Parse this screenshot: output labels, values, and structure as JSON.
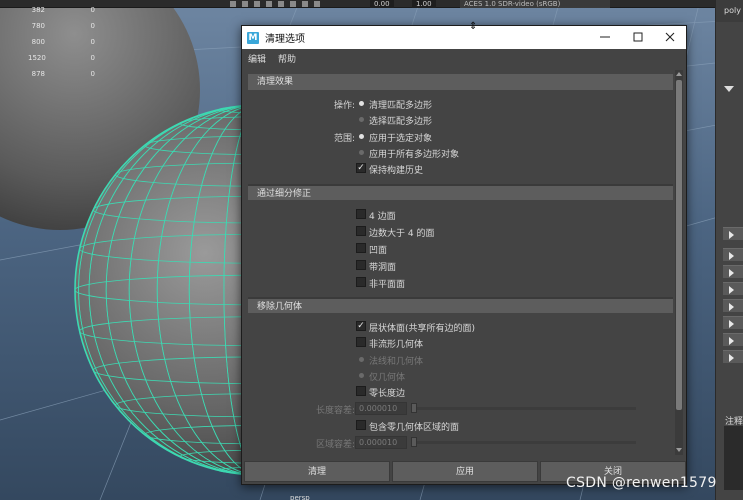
{
  "viewport": {
    "color_space": "ACES 1.0 SDR-video (sRGB)",
    "toolbar_values": [
      "0.00",
      "1.00"
    ],
    "hud_stats": [
      {
        "a": "382",
        "b": "0"
      },
      {
        "a": "780",
        "b": "0"
      },
      {
        "a": "800",
        "b": "0"
      },
      {
        "a": "1520",
        "b": "0"
      },
      {
        "a": "878",
        "b": "0"
      }
    ],
    "bottom_label": "persp",
    "wireframe_color": "#3dd9b2"
  },
  "right_panel": {
    "top_label": "poly",
    "notes_label": "注释"
  },
  "dialog": {
    "icon_letter": "M",
    "title": "清理选项",
    "menu": [
      "编辑",
      "帮助"
    ],
    "sections": {
      "cleanup": {
        "header": "清理效果",
        "operation_label": "操作:",
        "operation_options": [
          "清理匹配多边形",
          "选择匹配多边形"
        ],
        "scope_label": "范围:",
        "scope_options": [
          "应用于选定对象",
          "应用于所有多边形对象"
        ],
        "keep_history": "保持构建历史"
      },
      "tessellate": {
        "header": "通过细分修正",
        "options": [
          "4 边面",
          "边数大于 4 的面",
          "凹面",
          "带洞面",
          "非平面面"
        ]
      },
      "remove_geometry": {
        "header": "移除几何体",
        "lamina": "层状体面(共享所有边的面)",
        "nonmanifold": "非流形几何体",
        "nonmanifold_options": [
          "法线和几何体",
          "仅几何体"
        ],
        "zero_edge": "零长度边",
        "length_tolerance_label": "长度容差:",
        "length_tolerance_value": "0.000010",
        "zero_area_faces": "包含零几何体区域的面",
        "area_tolerance_label": "区域容差:",
        "area_tolerance_value": "0.000010"
      }
    },
    "buttons": [
      "清理",
      "应用",
      "关闭"
    ]
  },
  "watermark": "CSDN @renwen1579"
}
